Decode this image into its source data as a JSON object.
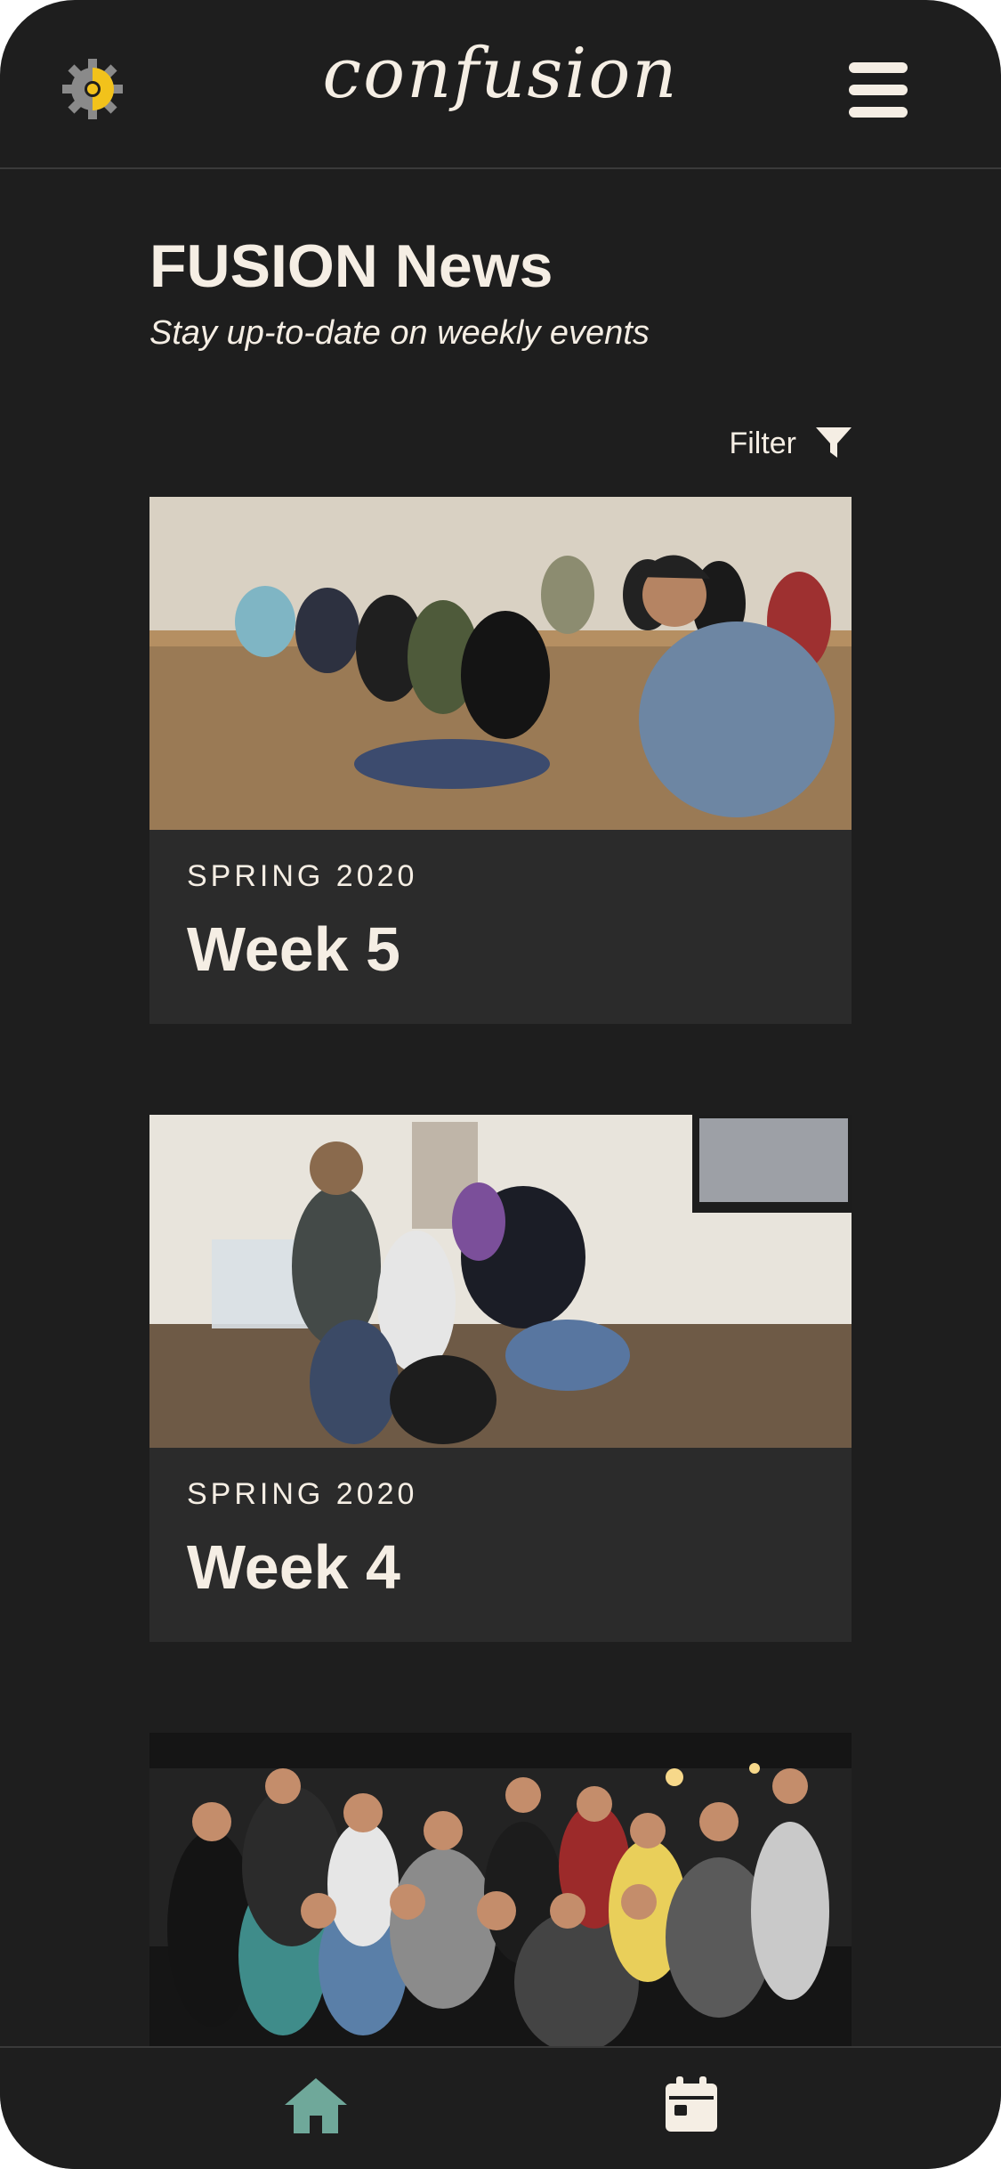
{
  "header": {
    "brand": "confusion",
    "logo_icon": "gear-sun-icon",
    "menu_icon": "hamburger-menu-icon"
  },
  "page": {
    "title": "FUSION News",
    "subtitle": "Stay up-to-date on weekly events"
  },
  "filter": {
    "label": "Filter",
    "icon": "funnel-icon"
  },
  "cards": [
    {
      "season": "SPRING 2020",
      "week": "Week 5",
      "image": "group seated on wooden floor photo"
    },
    {
      "season": "SPRING 2020",
      "week": "Week 4",
      "image": "tug-of-war game photo"
    },
    {
      "season": "",
      "week": "",
      "image": "large group outdoor night photo"
    }
  ],
  "bottom_nav": {
    "items": [
      {
        "icon": "home-icon",
        "active": true
      },
      {
        "icon": "calendar-icon",
        "active": false
      }
    ]
  },
  "colors": {
    "background": "#1e1e1e",
    "card": "#2b2b2b",
    "text": "#f5eee4",
    "accent_home": "#6fa89a",
    "logo_yellow": "#f2c21b",
    "logo_gray": "#8a8a8a"
  }
}
